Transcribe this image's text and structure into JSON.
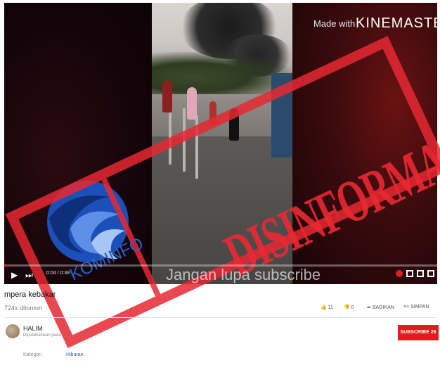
{
  "video": {
    "watermark_prefix": "Made with",
    "watermark_brand": "KINEMASTER",
    "time_display": "0:04 / 0:38",
    "caption": "Jangan lupa subscribe"
  },
  "stamp": {
    "text": "DISINFORMASI",
    "org": "KOMINFO"
  },
  "details": {
    "title": "mpera kebakar",
    "views": "724x ditonton",
    "like_count": "11",
    "dislike_count": "0",
    "share_label": "BAGIKAN",
    "save_label": "SIMPAN",
    "channel_name": "HALIM",
    "channel_date": "Dipublikasikan pada",
    "subscribe_label": "SUBSCRIBE 26",
    "category_label": "Kategori",
    "category_value": "Hiburan"
  },
  "colors": {
    "stamp_red": "#e62832",
    "subscribe_red": "#e21b1b",
    "kominfo_blue": "#2a62c8"
  }
}
